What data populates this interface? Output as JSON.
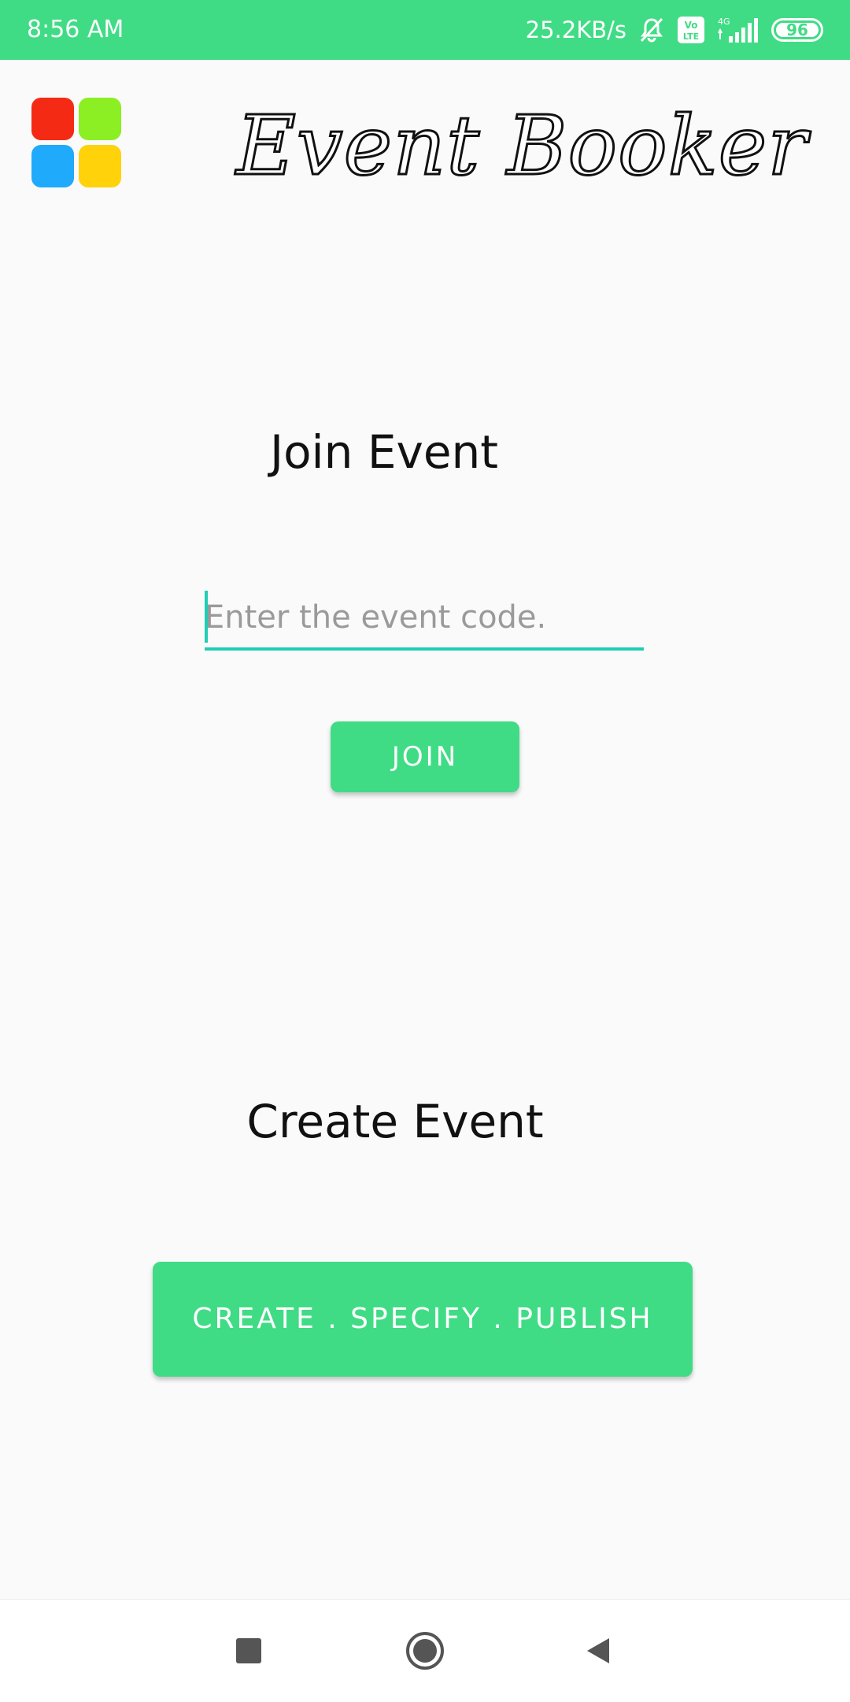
{
  "status_bar": {
    "time": "8:56 AM",
    "network_speed": "25.2KB/s",
    "volte_label": "Vo LTE",
    "network_type": "4G",
    "battery_level": "96",
    "color": "#40dc85",
    "icons": [
      "mute-bell-icon",
      "volte-icon",
      "signal-icon",
      "battery-icon"
    ]
  },
  "header": {
    "title": "Event Booker",
    "logo_colors": [
      "#f42a14",
      "#8bef24",
      "#20aafc",
      "#ffd20a"
    ]
  },
  "join": {
    "heading": "Join Event",
    "input_placeholder": "Enter the event code.",
    "input_value": "",
    "button_label": "JOIN"
  },
  "create": {
    "heading": "Create Event",
    "button_label": "CREATE . SPECIFY . PUBLISH"
  },
  "nav_bar": {
    "items": [
      "recents-square-icon",
      "home-circle-icon",
      "back-triangle-icon"
    ]
  },
  "colors": {
    "accent": "#40dc85",
    "input_underline": "#20cdb5",
    "background": "#fafafa"
  }
}
